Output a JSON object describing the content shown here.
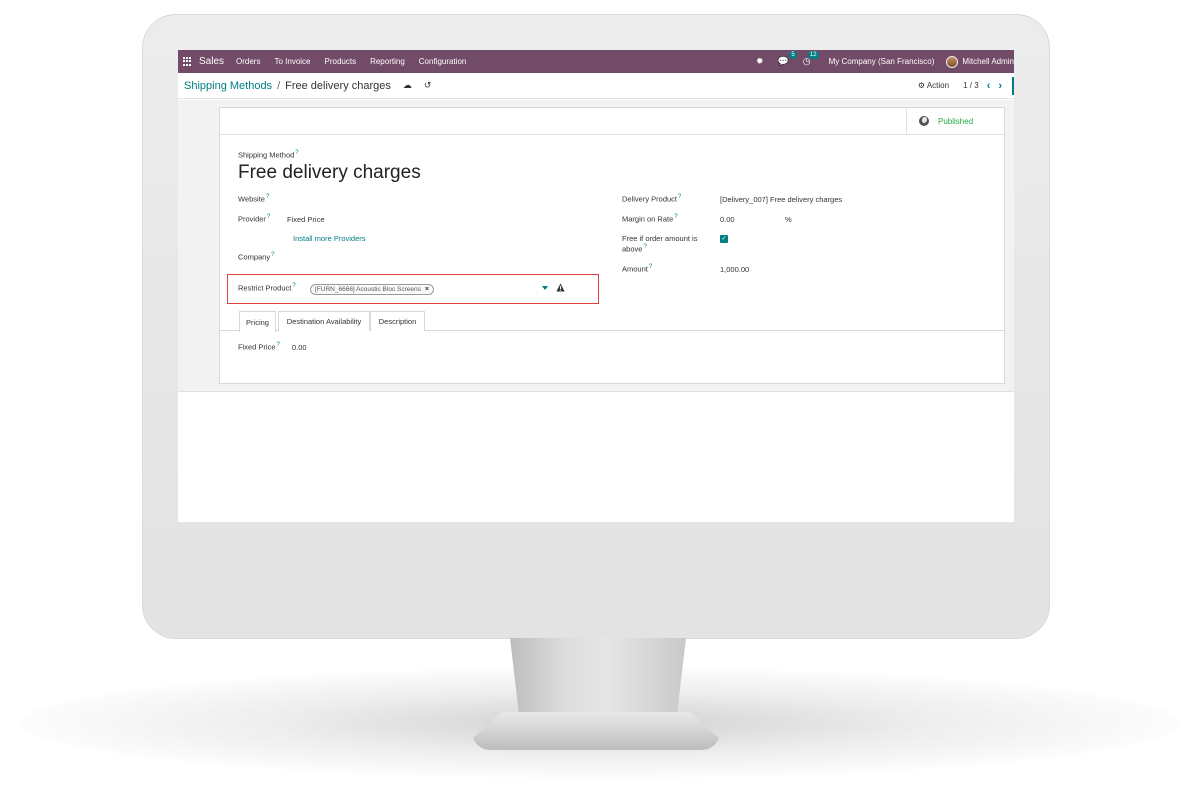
{
  "navbar": {
    "app_name": "Sales",
    "menus": [
      "Orders",
      "To Invoice",
      "Products",
      "Reporting",
      "Configuration"
    ],
    "messages_count": "5",
    "activities_count": "12",
    "company": "My Company (San Francisco)",
    "user": "Mitchell Admin",
    "color": "#714b67"
  },
  "control_panel": {
    "breadcrumb_parent": "Shipping Methods",
    "breadcrumb_separator": "/",
    "breadcrumb_current": "Free delivery charges",
    "action_label": "Action",
    "pager": "1 / 3"
  },
  "sheet": {
    "published_label": "Published",
    "shipping_method_label": "Shipping Method",
    "title": "Free delivery charges",
    "website_label": "Website",
    "provider_label": "Provider",
    "provider_value": "Fixed Price",
    "install_providers_link": "Install more Providers",
    "company_label": "Company",
    "restrict_product_label": "Restrict Product",
    "restrict_product_tag": "[FURN_6666] Acoustic Bloc Screens",
    "delivery_product_label": "Delivery Product",
    "delivery_product_value": "[Delivery_007] Free delivery charges",
    "margin_label": "Margin on Rate",
    "margin_value": "0.00",
    "margin_unit": "%",
    "free_if_label_1": "Free if order amount is",
    "free_if_label_2": "above",
    "free_if_checked": true,
    "amount_label": "Amount",
    "amount_value": "1,000.00",
    "help_mark": "?"
  },
  "tabs": [
    "Pricing",
    "Destination Availability",
    "Description"
  ],
  "pricing": {
    "fixed_price_label": "Fixed Price",
    "fixed_price_value": "0.00"
  },
  "colors": {
    "accent": "#017e84",
    "highlight_border": "#e04040",
    "published": "#28a745"
  }
}
